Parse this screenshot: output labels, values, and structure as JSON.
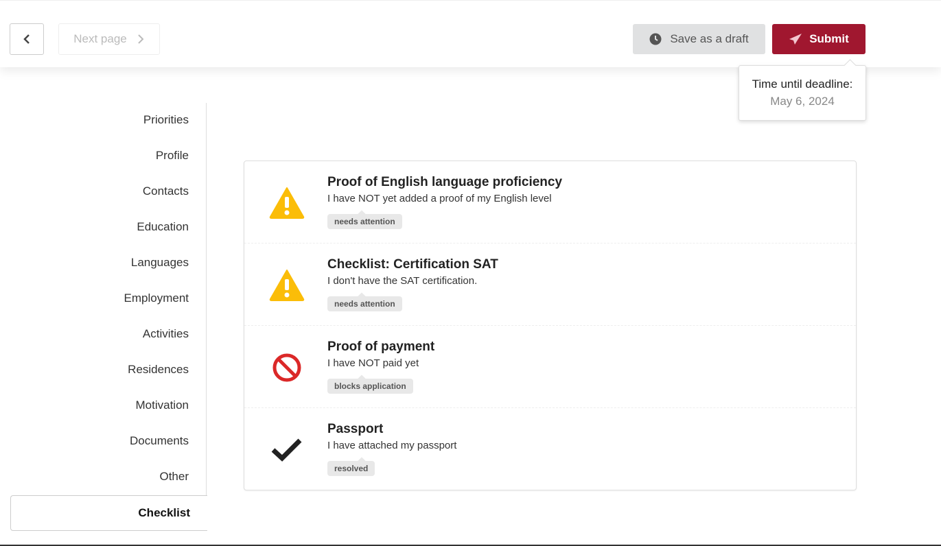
{
  "header": {
    "back_icon": "chevron-left-icon",
    "next_label": "Next page",
    "save_draft_label": "Save as a draft",
    "submit_label": "Submit"
  },
  "tooltip": {
    "label": "Time until deadline:",
    "date": "May 6, 2024"
  },
  "sidebar": {
    "items": [
      "Priorities",
      "Profile",
      "Contacts",
      "Education",
      "Languages",
      "Employment",
      "Activities",
      "Residences",
      "Motivation",
      "Documents",
      "Other"
    ],
    "active": "Checklist"
  },
  "checklist": [
    {
      "title": "Proof of English language proficiency",
      "description": "I have NOT yet added a proof of my English level",
      "tag": "needs attention",
      "icon": "warning-icon"
    },
    {
      "title": "Checklist: Certification SAT",
      "description": "I don't have the SAT certification.",
      "tag": "needs attention",
      "icon": "warning-icon"
    },
    {
      "title": "Proof of payment",
      "description": "I have NOT paid yet",
      "tag": "blocks application",
      "icon": "ban-icon"
    },
    {
      "title": "Passport",
      "description": "I have attached my passport",
      "tag": "resolved",
      "icon": "check-icon"
    }
  ],
  "colors": {
    "submit": "#a0172f",
    "warning": "#fbbd08",
    "error": "#db2828"
  }
}
